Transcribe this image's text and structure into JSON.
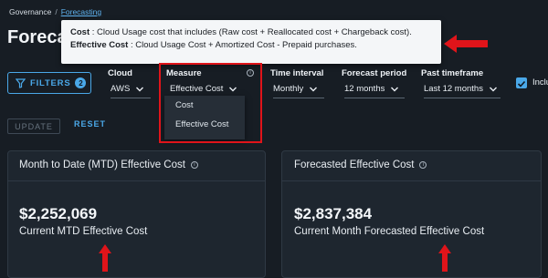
{
  "breadcrumb": {
    "root": "Governance",
    "separator": "/",
    "current": "Forecasting"
  },
  "page": {
    "title": "Forecasting"
  },
  "tooltip": {
    "line1_bold": "Cost",
    "line1_text": " : Cloud Usage cost that includes (Raw cost + Reallocated cost + Chargeback cost).",
    "line2_bold": "Effective Cost",
    "line2_text": " : Cloud Usage Cost + Amortized Cost - Prepaid purchases."
  },
  "filters": {
    "label": "FILTERS",
    "count": "2"
  },
  "fields": {
    "cloud": {
      "label": "Cloud",
      "value": "AWS"
    },
    "measure": {
      "label": "Measure",
      "value": "Effective Cost",
      "options": [
        "Cost",
        "Effective Cost"
      ]
    },
    "time_interval": {
      "label": "Time interval",
      "value": "Monthly"
    },
    "forecast_period": {
      "label": "Forecast period",
      "value": "12 months"
    },
    "past_timeframe": {
      "label": "Past timeframe",
      "value": "Last 12 months"
    },
    "include": {
      "label": "Inclu"
    }
  },
  "actions": {
    "update": "UPDATE",
    "reset": "RESET"
  },
  "cards": [
    {
      "title": "Month to Date (MTD) Effective Cost",
      "value": "$2,252,069",
      "subtitle": "Current MTD Effective Cost"
    },
    {
      "title": "Forecasted Effective Cost",
      "value": "$2,837,384",
      "subtitle": "Current Month Forecasted Effective Cost"
    }
  ],
  "colors": {
    "accent": "#4aa8e8",
    "highlight": "#e0141a",
    "background": "#171d24"
  }
}
